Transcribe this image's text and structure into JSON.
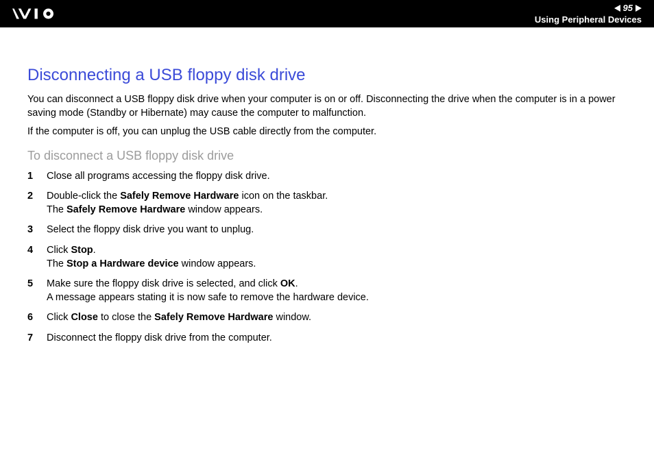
{
  "header": {
    "page_number": "95",
    "section": "Using Peripheral Devices"
  },
  "title": "Disconnecting a USB floppy disk drive",
  "intro_p1": "You can disconnect a USB floppy disk drive when your computer is on or off. Disconnecting the drive when the computer is in a power saving mode (Standby or Hibernate) may cause the computer to malfunction.",
  "intro_p2": "If the computer is off, you can unplug the USB cable directly from the computer.",
  "subheading": "To disconnect a USB floppy disk drive",
  "steps": [
    {
      "parts": [
        {
          "t": "Close all programs accessing the floppy disk drive."
        }
      ]
    },
    {
      "parts": [
        {
          "t": "Double-click the "
        },
        {
          "t": "Safely Remove Hardware",
          "b": true
        },
        {
          "t": " icon on the taskbar."
        },
        {
          "br": true
        },
        {
          "t": "The "
        },
        {
          "t": "Safely Remove Hardware",
          "b": true
        },
        {
          "t": " window appears."
        }
      ]
    },
    {
      "parts": [
        {
          "t": "Select the floppy disk drive you want to unplug."
        }
      ]
    },
    {
      "parts": [
        {
          "t": "Click "
        },
        {
          "t": "Stop",
          "b": true
        },
        {
          "t": "."
        },
        {
          "br": true
        },
        {
          "t": "The "
        },
        {
          "t": "Stop a Hardware device",
          "b": true
        },
        {
          "t": " window appears."
        }
      ]
    },
    {
      "parts": [
        {
          "t": "Make sure the floppy disk drive is selected, and click "
        },
        {
          "t": "OK",
          "b": true
        },
        {
          "t": "."
        },
        {
          "br": true
        },
        {
          "t": "A message appears stating it is now safe to remove the hardware device."
        }
      ]
    },
    {
      "parts": [
        {
          "t": "Click "
        },
        {
          "t": "Close",
          "b": true
        },
        {
          "t": " to close the "
        },
        {
          "t": "Safely Remove Hardware",
          "b": true
        },
        {
          "t": " window."
        }
      ]
    },
    {
      "parts": [
        {
          "t": "Disconnect the floppy disk drive from the computer."
        }
      ]
    }
  ]
}
